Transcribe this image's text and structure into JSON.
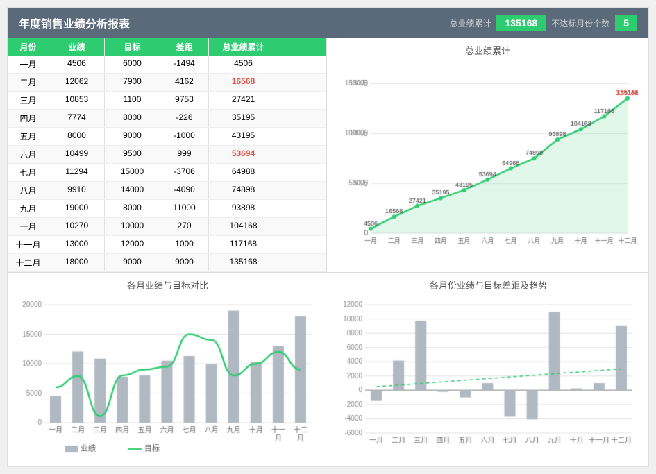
{
  "header": {
    "title": "年度销售业绩分析报表",
    "total_label": "总业绩累计",
    "total_value": "135168",
    "not_reach_label": "不达标月份个数",
    "not_reach_value": "5"
  },
  "table": {
    "columns": [
      "月份",
      "业绩",
      "目标",
      "差距",
      "总业绩累计"
    ],
    "rows": [
      [
        "一月",
        "4506",
        "6000",
        "-1494",
        "4506"
      ],
      [
        "二月",
        "12062",
        "7900",
        "4162",
        "16568"
      ],
      [
        "三月",
        "10853",
        "1100",
        "9753",
        "27421"
      ],
      [
        "四月",
        "7774",
        "8000",
        "-226",
        "35195"
      ],
      [
        "五月",
        "8000",
        "9000",
        "-1000",
        "43195"
      ],
      [
        "六月",
        "10499",
        "9500",
        "999",
        "53694"
      ],
      [
        "七月",
        "11294",
        "15000",
        "-3706",
        "64988"
      ],
      [
        "八月",
        "9910",
        "14000",
        "-4090",
        "74898"
      ],
      [
        "九月",
        "19000",
        "8000",
        "11000",
        "93898"
      ],
      [
        "十月",
        "10270",
        "10000",
        "270",
        "104168"
      ],
      [
        "十一月",
        "13000",
        "12000",
        "1000",
        "117168"
      ],
      [
        "十二月",
        "18000",
        "9000",
        "9000",
        "135168"
      ]
    ]
  },
  "chart1": {
    "title": "总业绩累计",
    "months": [
      "一月",
      "二月",
      "三月",
      "四月",
      "五月",
      "六月",
      "七月",
      "八月",
      "九月",
      "十月",
      "十一月",
      "十二月"
    ],
    "values": [
      4506,
      16568,
      27421,
      35195,
      43195,
      53694,
      64988,
      74898,
      93898,
      104168,
      117168,
      135168
    ]
  },
  "chart2": {
    "title": "各月业绩与目标对比",
    "months": [
      "一月",
      "二月",
      "三月",
      "四月",
      "五月",
      "六月",
      "七月",
      "八月",
      "九月",
      "十月",
      "十一月\n月",
      "十二\n月"
    ],
    "performance": [
      4506,
      12062,
      10853,
      7774,
      8000,
      10499,
      11294,
      9910,
      19000,
      10270,
      13000,
      18000
    ],
    "target": [
      6000,
      7900,
      1100,
      8000,
      9000,
      9500,
      15000,
      14000,
      8000,
      10000,
      12000,
      9000
    ]
  },
  "chart3": {
    "title": "各月份业绩与目标差距及趋势",
    "months": [
      "一月",
      "二月",
      "三月",
      "四月",
      "五月",
      "六月",
      "七月",
      "八月",
      "九月",
      "十月",
      "十一月",
      "十二月"
    ],
    "diff": [
      -1494,
      4162,
      9753,
      -226,
      -1000,
      999,
      -3706,
      -4090,
      11000,
      270,
      1000,
      9000
    ]
  }
}
